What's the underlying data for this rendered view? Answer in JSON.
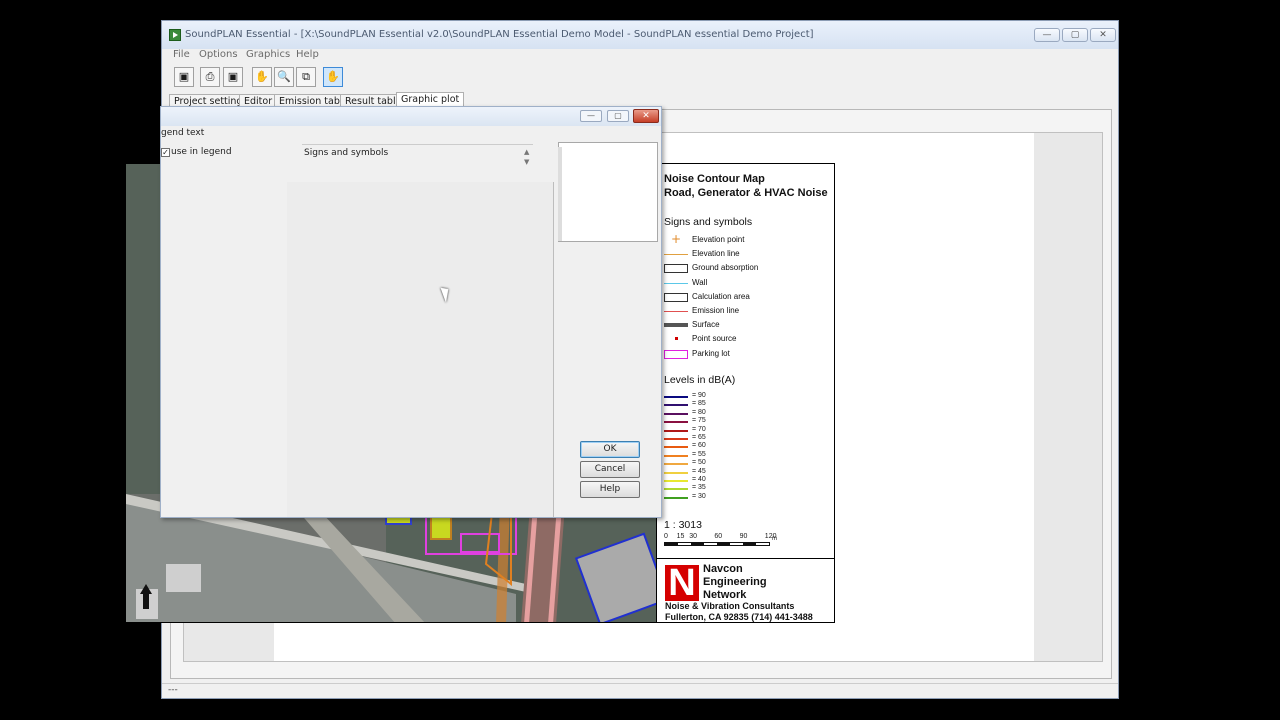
{
  "window": {
    "title": "SoundPLAN Essential - [X:\\SoundPLAN Essential v2.0\\SoundPLAN Essential Demo Model - SoundPLAN essential Demo Project]",
    "minimize": "—",
    "maximize": "▢",
    "close": "✕"
  },
  "menu": [
    "File",
    "Options",
    "Graphics",
    "Help"
  ],
  "toolbar": {
    "icons": [
      "save-icon",
      "print-icon",
      "export-icon",
      "pan-hand-icon",
      "zoom-icon",
      "copy-window-icon",
      "select-hand-icon"
    ],
    "glyphs": [
      "▣",
      "⎙",
      "▣",
      "✋",
      "🔍",
      "⧉",
      "✋"
    ]
  },
  "tabs": [
    "Project settings",
    "Editor",
    "Emission table",
    "Result table",
    "Graphic plot"
  ],
  "status": "---",
  "legend": {
    "title_line1": "Noise Contour Map",
    "title_line2": "Road, Generator & HVAC Noise",
    "signs_heading": "Signs and symbols",
    "signs": [
      {
        "label": "Elevation point",
        "icon": "plus",
        "color": "#e08a2a"
      },
      {
        "label": "Elevation line",
        "icon": "line",
        "color": "#e0a040"
      },
      {
        "label": "Ground absorption",
        "icon": "box",
        "color": "#333333"
      },
      {
        "label": "Wall",
        "icon": "line",
        "color": "#5bc8e8"
      },
      {
        "label": "Calculation area",
        "icon": "box",
        "color": "#333333"
      },
      {
        "label": "Emission line",
        "icon": "line",
        "color": "#e05050"
      },
      {
        "label": "Surface",
        "icon": "thick",
        "color": "#555555"
      },
      {
        "label": "Point source",
        "icon": "dot",
        "color": "#d00000"
      },
      {
        "label": "Parking lot",
        "icon": "box",
        "color": "#e020e0"
      }
    ],
    "levels_heading": "Levels in dB(A)",
    "levels": [
      {
        "label": "=  90",
        "color": "#0a0a80"
      },
      {
        "label": "=  85",
        "color": "#301070"
      },
      {
        "label": "=  80",
        "color": "#5a1060"
      },
      {
        "label": "=  75",
        "color": "#8a1040"
      },
      {
        "label": "=  70",
        "color": "#b01818"
      },
      {
        "label": "=  65",
        "color": "#d83a1a"
      },
      {
        "label": "=  60",
        "color": "#e85a10"
      },
      {
        "label": "=  55",
        "color": "#f08020"
      },
      {
        "label": "=  50",
        "color": "#f0a840"
      },
      {
        "label": "=  45",
        "color": "#f0d040"
      },
      {
        "label": "=  40",
        "color": "#e8e830"
      },
      {
        "label": "=  35",
        "color": "#b0d830"
      },
      {
        "label": "=  30",
        "color": "#40a020"
      }
    ],
    "scale": "1 : 3013",
    "scale_ticks": [
      "0",
      "15",
      "30",
      "60",
      "90",
      "120"
    ],
    "scale_unit": "m",
    "company": [
      "Navcon",
      "Engineering",
      "Network"
    ],
    "company_sub": "Noise & Vibration Consultants",
    "company_addr": "Fullerton, CA 92835 (714) 441-3488",
    "logo_letter": "N"
  },
  "dialog": {
    "legend_text_label": "gend text",
    "use_in_legend_label": "use in legend",
    "checkbox_mark": "✓",
    "selected_value": "Signs and symbols",
    "arrows": "▲\n▼",
    "ok": "OK",
    "cancel": "Cancel",
    "help": "Help"
  }
}
